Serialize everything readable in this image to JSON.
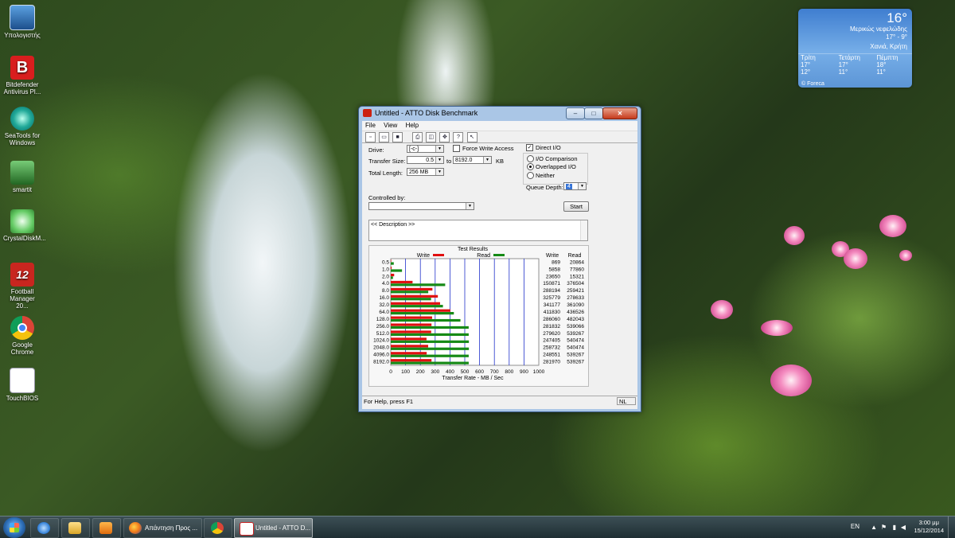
{
  "desktop_icons": [
    {
      "label": "Υπολογιστής",
      "icon": "computer-icon"
    },
    {
      "label": "Bitdefender Antivirus Pl...",
      "icon": "bitdefender-icon"
    },
    {
      "label": "SeaTools for Windows",
      "icon": "seatools-icon"
    },
    {
      "label": "smartit",
      "icon": "smart-icon"
    },
    {
      "label": "CrystalDiskM...",
      "icon": "crystaldiskmark-icon"
    },
    {
      "label": "Football Manager 20...",
      "icon": "football-manager-icon"
    },
    {
      "label": "Google Chrome",
      "icon": "chrome-icon"
    },
    {
      "label": "TouchBIOS",
      "icon": "touchbios-icon"
    }
  ],
  "weather": {
    "temp": "16°",
    "condition": "Μερικώς νεφελώδης",
    "range": "17° - 9°",
    "city": "Χανιά, Κρήτη",
    "days": [
      {
        "name": "Τρίτη",
        "high": "17°",
        "low": "12°"
      },
      {
        "name": "Τετάρτη",
        "high": "17°",
        "low": "11°"
      },
      {
        "name": "Πέμπτη",
        "high": "18°",
        "low": "11°"
      }
    ],
    "source": "© Foreca"
  },
  "window": {
    "title": "Untitled - ATTO Disk Benchmark",
    "controls": {
      "minimize": "–",
      "maximize": "□",
      "close": "✕"
    },
    "menu": [
      "File",
      "View",
      "Help"
    ],
    "toolbar_icons": [
      "new-icon",
      "open-icon",
      "save-icon",
      "print-icon",
      "print-preview-icon",
      "move-icon",
      "help-icon",
      "context-help-icon"
    ],
    "settings": {
      "drive_label": "Drive:",
      "drive_value": "[-c-]",
      "force_write_label": "Force Write Access",
      "force_write_checked": false,
      "direct_io_label": "Direct I/O",
      "direct_io_checked": true,
      "transfer_size_label": "Transfer Size:",
      "transfer_size_from": "0.5",
      "to_label": "to",
      "transfer_size_to": "8192.0",
      "kb_label": "KB",
      "total_length_label": "Total Length:",
      "total_length_value": "256 MB",
      "io_comparison_label": "I/O Comparison",
      "overlapped_io_label": "Overlapped I/O",
      "neither_label": "Neither",
      "selected_io_mode": "Overlapped I/O",
      "queue_depth_label": "Queue Depth:",
      "queue_depth_value": "4",
      "controlled_by_label": "Controlled by:",
      "controlled_by_value": "",
      "start_label": "Start",
      "description": "<< Description >>"
    },
    "results_header": {
      "title": "Test Results",
      "write_legend": "Write",
      "read_legend": "Read",
      "col_write": "Write",
      "col_read": "Read"
    },
    "status_text": "For Help, press F1",
    "status_indicator": "NL"
  },
  "chart_data": {
    "type": "bar",
    "title": "Test Results",
    "xlabel": "Transfer Rate - MB / Sec",
    "xlim": [
      0,
      1000
    ],
    "x_ticks": [
      "0",
      "100",
      "200",
      "300",
      "400",
      "500",
      "600",
      "700",
      "800",
      "900",
      "1000"
    ],
    "categories": [
      "0.5",
      "1.0",
      "2.0",
      "4.0",
      "8.0",
      "16.0",
      "32.0",
      "64.0",
      "128.0",
      "256.0",
      "512.0",
      "1024.0",
      "2048.0",
      "4096.0",
      "8192.0"
    ],
    "series": [
      {
        "name": "Write",
        "color": "#e01010",
        "values": [
          0.8,
          5.7,
          23.1,
          147.3,
          281.4,
          318.1,
          333.2,
          402.2,
          279.4,
          275.2,
          273.1,
          241.6,
          252.7,
          242.7,
          275.4
        ]
      },
      {
        "name": "Read",
        "color": "#168a16",
        "values": [
          20.4,
          76.0,
          15.0,
          367.7,
          253.3,
          272.1,
          352.6,
          426.3,
          470.7,
          526.4,
          526.6,
          527.8,
          527.8,
          526.6,
          526.6
        ]
      }
    ],
    "table": [
      {
        "write": "869",
        "read": "20864"
      },
      {
        "write": "5858",
        "read": "77860"
      },
      {
        "write": "23650",
        "read": "15321"
      },
      {
        "write": "150871",
        "read": "376504"
      },
      {
        "write": "288194",
        "read": "259421"
      },
      {
        "write": "325779",
        "read": "278633"
      },
      {
        "write": "341177",
        "read": "361090"
      },
      {
        "write": "411830",
        "read": "436526"
      },
      {
        "write": "286060",
        "read": "482043"
      },
      {
        "write": "281832",
        "read": "539066"
      },
      {
        "write": "279620",
        "read": "539267"
      },
      {
        "write": "247405",
        "read": "540474"
      },
      {
        "write": "258732",
        "read": "540474"
      },
      {
        "write": "248551",
        "read": "539267"
      },
      {
        "write": "281970",
        "read": "539267"
      }
    ]
  },
  "taskbar": {
    "items": [
      {
        "label": "",
        "icon": "internet-explorer-icon"
      },
      {
        "label": "",
        "icon": "file-explorer-icon"
      },
      {
        "label": "",
        "icon": "media-player-icon"
      },
      {
        "label": "Απάντηση Προς ...",
        "icon": "firefox-icon"
      },
      {
        "label": "",
        "icon": "chrome-icon"
      },
      {
        "label": "Untitled - ATTO D...",
        "icon": "atto-icon"
      }
    ],
    "language": "EN",
    "time": "3:00 μμ",
    "date": "15/12/2014"
  }
}
